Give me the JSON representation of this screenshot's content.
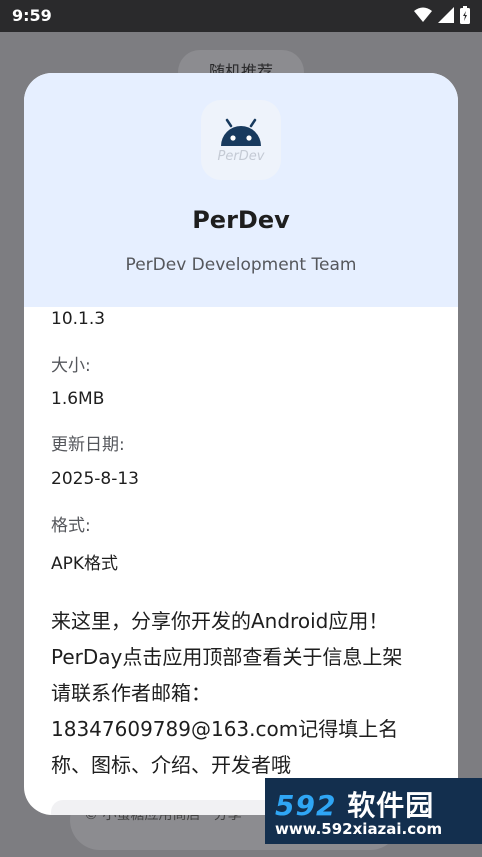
{
  "status_bar": {
    "time": "9:59",
    "icons": [
      "wifi-icon",
      "signal-icon",
      "battery-icon"
    ]
  },
  "background": {
    "pill_label": "随机推荐",
    "bottom_text": "© 小蜜糖应用商店 · 分享"
  },
  "dialog": {
    "app_name": "PerDev",
    "developer": "PerDev Development Team",
    "icon_text": "PerDev",
    "version_value": "10.1.3",
    "size_label": "大小:",
    "size_value": "1.6MB",
    "updated_label": "更新日期:",
    "updated_value": "2025-8-13",
    "format_label": "格式:",
    "format_value": "APK格式",
    "description_lines": [
      "来这里，分享你开发的Android应用！",
      "PerDay点击应用顶部查看关于信息上架",
      "请联系作者邮箱：",
      "18347609789@163.com记得填上名",
      "称、图标、介绍、开发者哦"
    ]
  },
  "watermark": {
    "brand_number": "592",
    "brand_text": "软件园",
    "url": "www.592xiazai.com"
  },
  "colors": {
    "header_bg": "#e6efff",
    "android_icon": "#183a5e",
    "scrim": "#7d7d81"
  }
}
